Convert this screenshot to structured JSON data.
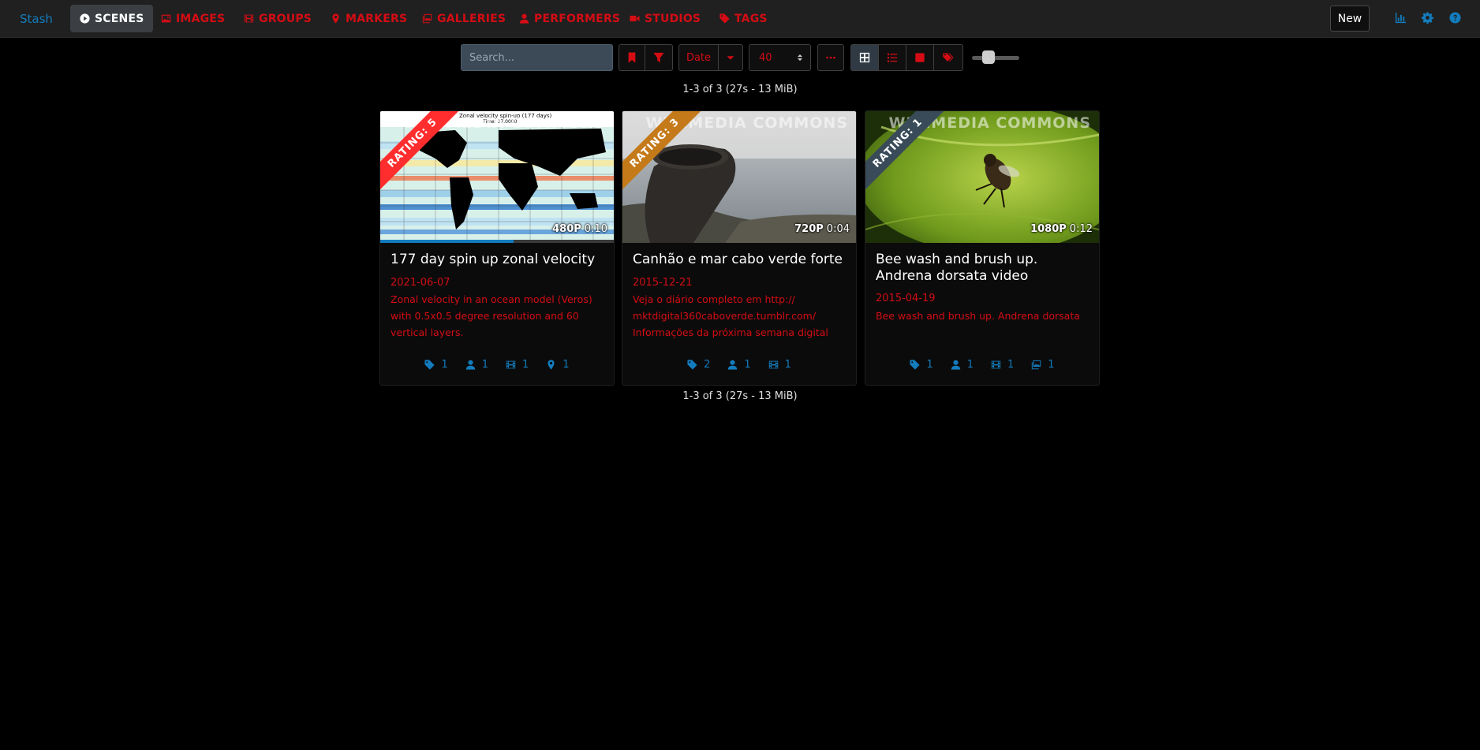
{
  "nav": {
    "brand": "Stash",
    "items": [
      {
        "label": "SCENES",
        "icon": "play-circle-icon",
        "active": true
      },
      {
        "label": "IMAGES",
        "icon": "image-icon"
      },
      {
        "label": "GROUPS",
        "icon": "film-icon"
      },
      {
        "label": "MARKERS",
        "icon": "map-marker-icon"
      },
      {
        "label": "GALLERIES",
        "icon": "images-icon"
      },
      {
        "label": "PERFORMERS",
        "icon": "user-icon"
      },
      {
        "label": "STUDIOS",
        "icon": "video-camera-icon"
      },
      {
        "label": "TAGS",
        "icon": "tag-icon"
      }
    ],
    "new_label": "New",
    "right_icons": [
      "chart-icon",
      "gear-icon",
      "help-icon"
    ]
  },
  "toolbar": {
    "search_placeholder": "Search...",
    "sort_by": "Date",
    "per_page": "40"
  },
  "results": {
    "count_top": "1-3 of 3 (27s - 13 MiB)",
    "count_bottom": "1-3 of 3 (27s - 13 MiB)"
  },
  "colors": {
    "accent_red": "#d50c14",
    "accent_blue": "#137cbd",
    "rating_5": "#ff2d2d",
    "rating_3": "#c57a1a",
    "rating_1": "#394b59"
  },
  "cards": [
    {
      "title": "177 day spin up zonal velocity",
      "date": "2021-06-07",
      "description": "Zonal velocity in an ocean model (Veros) with 0.5x0.5 degree resolution and 60 vertical layers.",
      "rating": "RATING: 5",
      "resolution": "480P",
      "duration": "0:10",
      "watermark": "WIKIMEDIA COMMONS",
      "thumb_caption": "Zonal velocity spin-up (177 days)",
      "thumb_time": "Time: 37.0000",
      "progress_percent": 57,
      "popovers": [
        {
          "icon": "tag-icon",
          "count": "1"
        },
        {
          "icon": "user-icon",
          "count": "1"
        },
        {
          "icon": "film-icon",
          "count": "1"
        },
        {
          "icon": "map-marker-icon",
          "count": "1"
        }
      ]
    },
    {
      "title": "Canhão e mar cabo verde forte",
      "date": "2015-12-21",
      "description": "Veja o diário completo em http:// mktdigital360caboverde.tumblr.com/ Informações da próxima semana digital já...",
      "rating": "RATING: 3",
      "resolution": "720P",
      "duration": "0:04",
      "watermark": "WIKIMEDIA COMMONS",
      "popovers": [
        {
          "icon": "tag-icon",
          "count": "2"
        },
        {
          "icon": "user-icon",
          "count": "1"
        },
        {
          "icon": "film-icon",
          "count": "1"
        }
      ]
    },
    {
      "title": "Bee wash and brush up. Andrena dorsata video",
      "date": "2015-04-19",
      "description": "Bee wash and brush up. Andrena dorsata",
      "rating": "RATING: 1",
      "resolution": "1080P",
      "duration": "0:12",
      "watermark": "WIKIMEDIA COMMONS",
      "popovers": [
        {
          "icon": "tag-icon",
          "count": "1"
        },
        {
          "icon": "user-icon",
          "count": "1"
        },
        {
          "icon": "film-icon",
          "count": "1"
        },
        {
          "icon": "images-icon",
          "count": "1"
        }
      ]
    }
  ]
}
